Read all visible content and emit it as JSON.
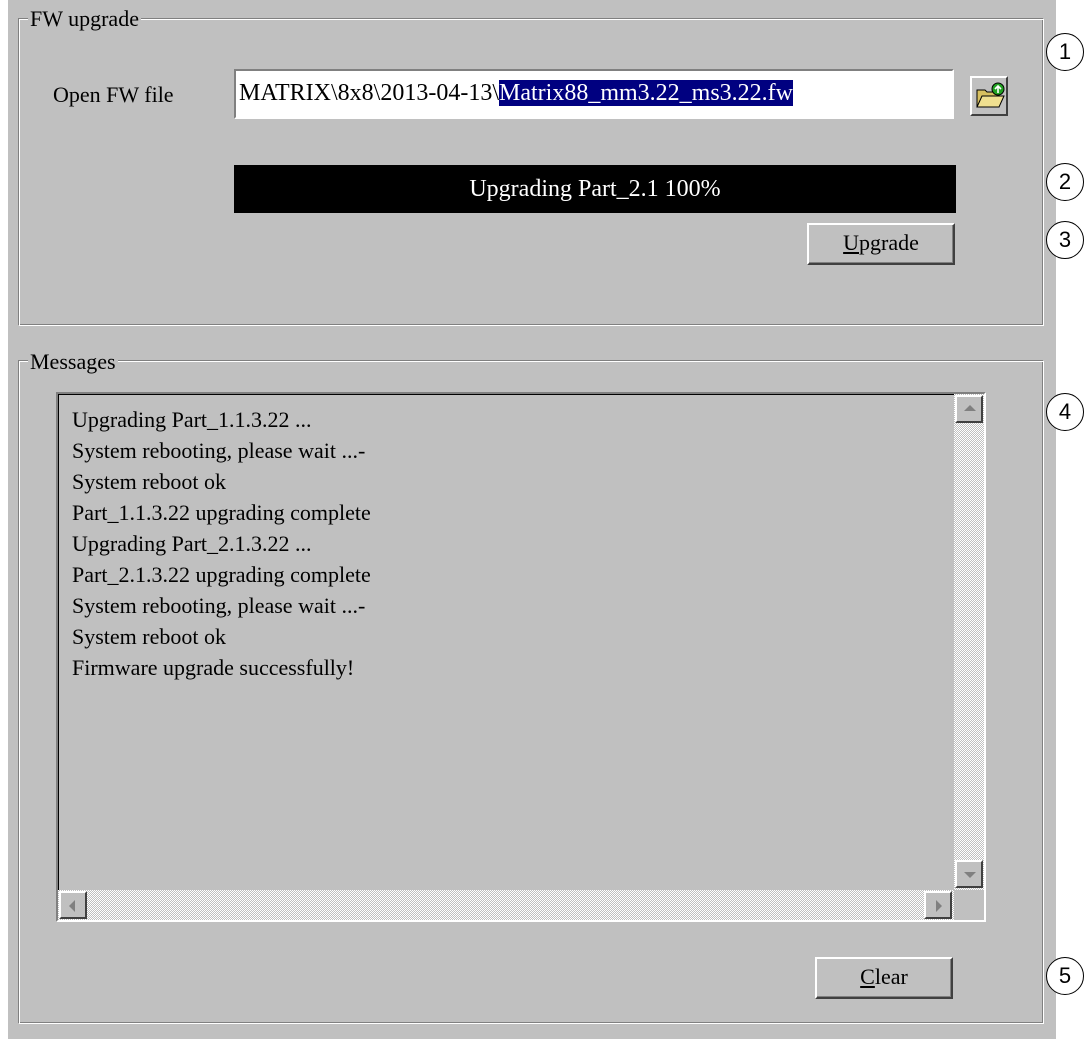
{
  "fw_upgrade": {
    "group_title": "FW upgrade",
    "open_label": "Open FW file",
    "file_path_prefix": "MATRIX\\8x8\\2013-04-13\\",
    "file_path_selected": "Matrix88_mm3.22_ms3.22.fw",
    "browse_icon": "folder-open-icon",
    "progress_text": "Upgrading Part_2.1 100%",
    "progress_value": 1.0,
    "upgrade_button": {
      "mnemonic": "U",
      "rest": "pgrade"
    }
  },
  "messages": {
    "group_title": "Messages",
    "lines": [
      "Upgrading Part_1.1.3.22 ...",
      "System rebooting, please wait ...-",
      "System reboot ok",
      "Part_1.1.3.22 upgrading complete",
      "Upgrading Part_2.1.3.22 ...",
      "Part_2.1.3.22 upgrading complete",
      "System rebooting, please wait ...-",
      "System reboot ok",
      "Firmware upgrade successfully!"
    ],
    "clear_button": {
      "mnemonic": "C",
      "rest": "lear"
    }
  },
  "callouts": [
    "1",
    "2",
    "3",
    "4",
    "5"
  ],
  "colors": {
    "dialog_bg": "#c0c0c0",
    "selection_bg": "#000080",
    "progress_bg": "#000000"
  }
}
